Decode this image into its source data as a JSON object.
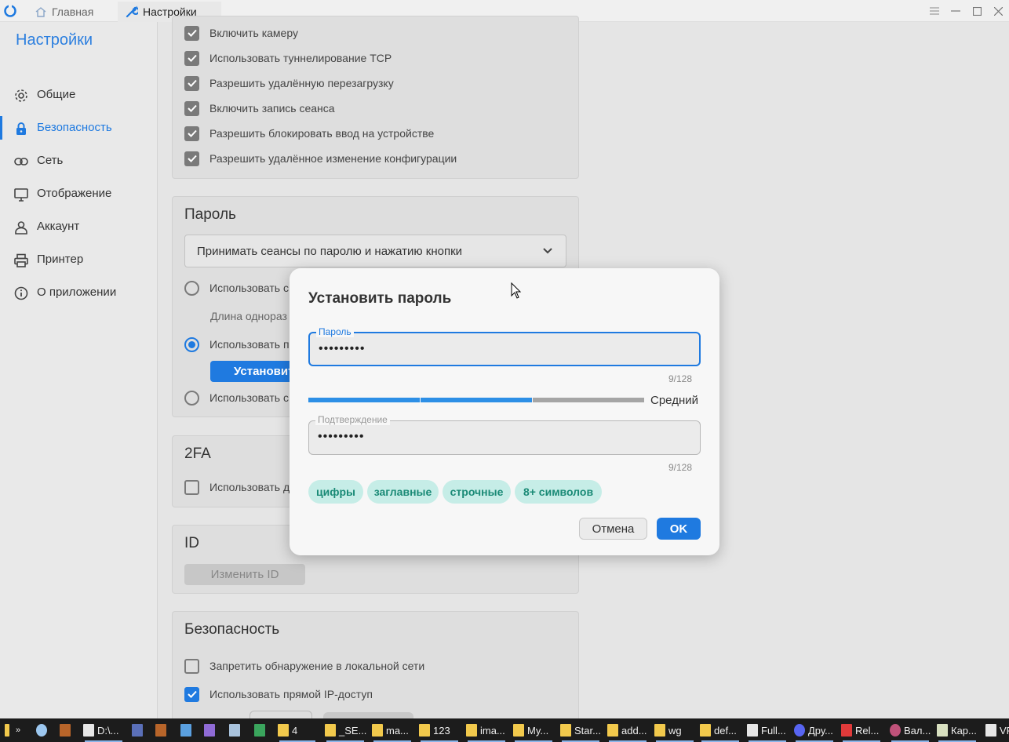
{
  "titlebar": {
    "tabs": [
      {
        "label": "Главная",
        "icon": "home-icon"
      },
      {
        "label": "Настройки",
        "icon": "wrench-icon"
      }
    ]
  },
  "sidebar": {
    "title": "Настройки",
    "items": [
      {
        "label": "Общие",
        "icon": "gear-icon"
      },
      {
        "label": "Безопасность",
        "icon": "lock-icon",
        "active": true
      },
      {
        "label": "Сеть",
        "icon": "link-icon"
      },
      {
        "label": "Отображение",
        "icon": "monitor-icon"
      },
      {
        "label": "Аккаунт",
        "icon": "person-icon"
      },
      {
        "label": "Принтер",
        "icon": "printer-icon"
      },
      {
        "label": "О приложении",
        "icon": "info-icon"
      }
    ]
  },
  "permissions": {
    "items": [
      "Включить камеру",
      "Использовать туннелирование TCP",
      "Разрешить удалённую перезагрузку",
      "Включить запись сеанса",
      "Разрешить блокировать ввод на устройстве",
      "Разрешить удалённое изменение конфигурации"
    ]
  },
  "password_section": {
    "title": "Пароль",
    "select_value": "Принимать сеансы по паролю и нажатию кнопки",
    "radio_1": "Использовать с",
    "length_label": "Длина однораз",
    "radio_2": "Использовать п",
    "set_button": "Установит",
    "radio_3": "Использовать с"
  },
  "twofa_section": {
    "title": "2FA",
    "checkbox": "Использовать д"
  },
  "id_section": {
    "title": "ID",
    "button": "Изменить ID"
  },
  "security_section": {
    "title": "Безопасность",
    "items": [
      {
        "label": "Запретить обнаружение в локальной сети",
        "checked": false
      },
      {
        "label": "Использовать прямой IP-доступ",
        "checked": true
      }
    ]
  },
  "dialog": {
    "title": "Установить пароль",
    "password_label": "Пароль",
    "password_value": "•••••••••",
    "password_counter": "9/128",
    "strength_label": "Средний",
    "strength_level": 0.67,
    "confirm_label": "Подтверждение",
    "confirm_value": "•••••••••",
    "confirm_counter": "9/128",
    "chips": [
      "цифры",
      "заглавные",
      "строчные",
      "8+ символов"
    ],
    "cancel_label": "Отмена",
    "ok_label": "OK"
  },
  "taskbar": {
    "items": [
      "D:\\...",
      "4",
      "_SE...",
      "ma...",
      "123",
      "ima...",
      "My...",
      "Star...",
      "add...",
      "wg",
      "def...",
      "Full...",
      "Дру...",
      "Rel...",
      "Вал...",
      "Кар...",
      "VP"
    ]
  },
  "colors": {
    "accent": "#1f7ae0",
    "strength_fill": "#2d8fe6",
    "strength_empty": "#a5a5a5",
    "chip_bg": "#c6ede7",
    "chip_text": "#1a8a76"
  }
}
